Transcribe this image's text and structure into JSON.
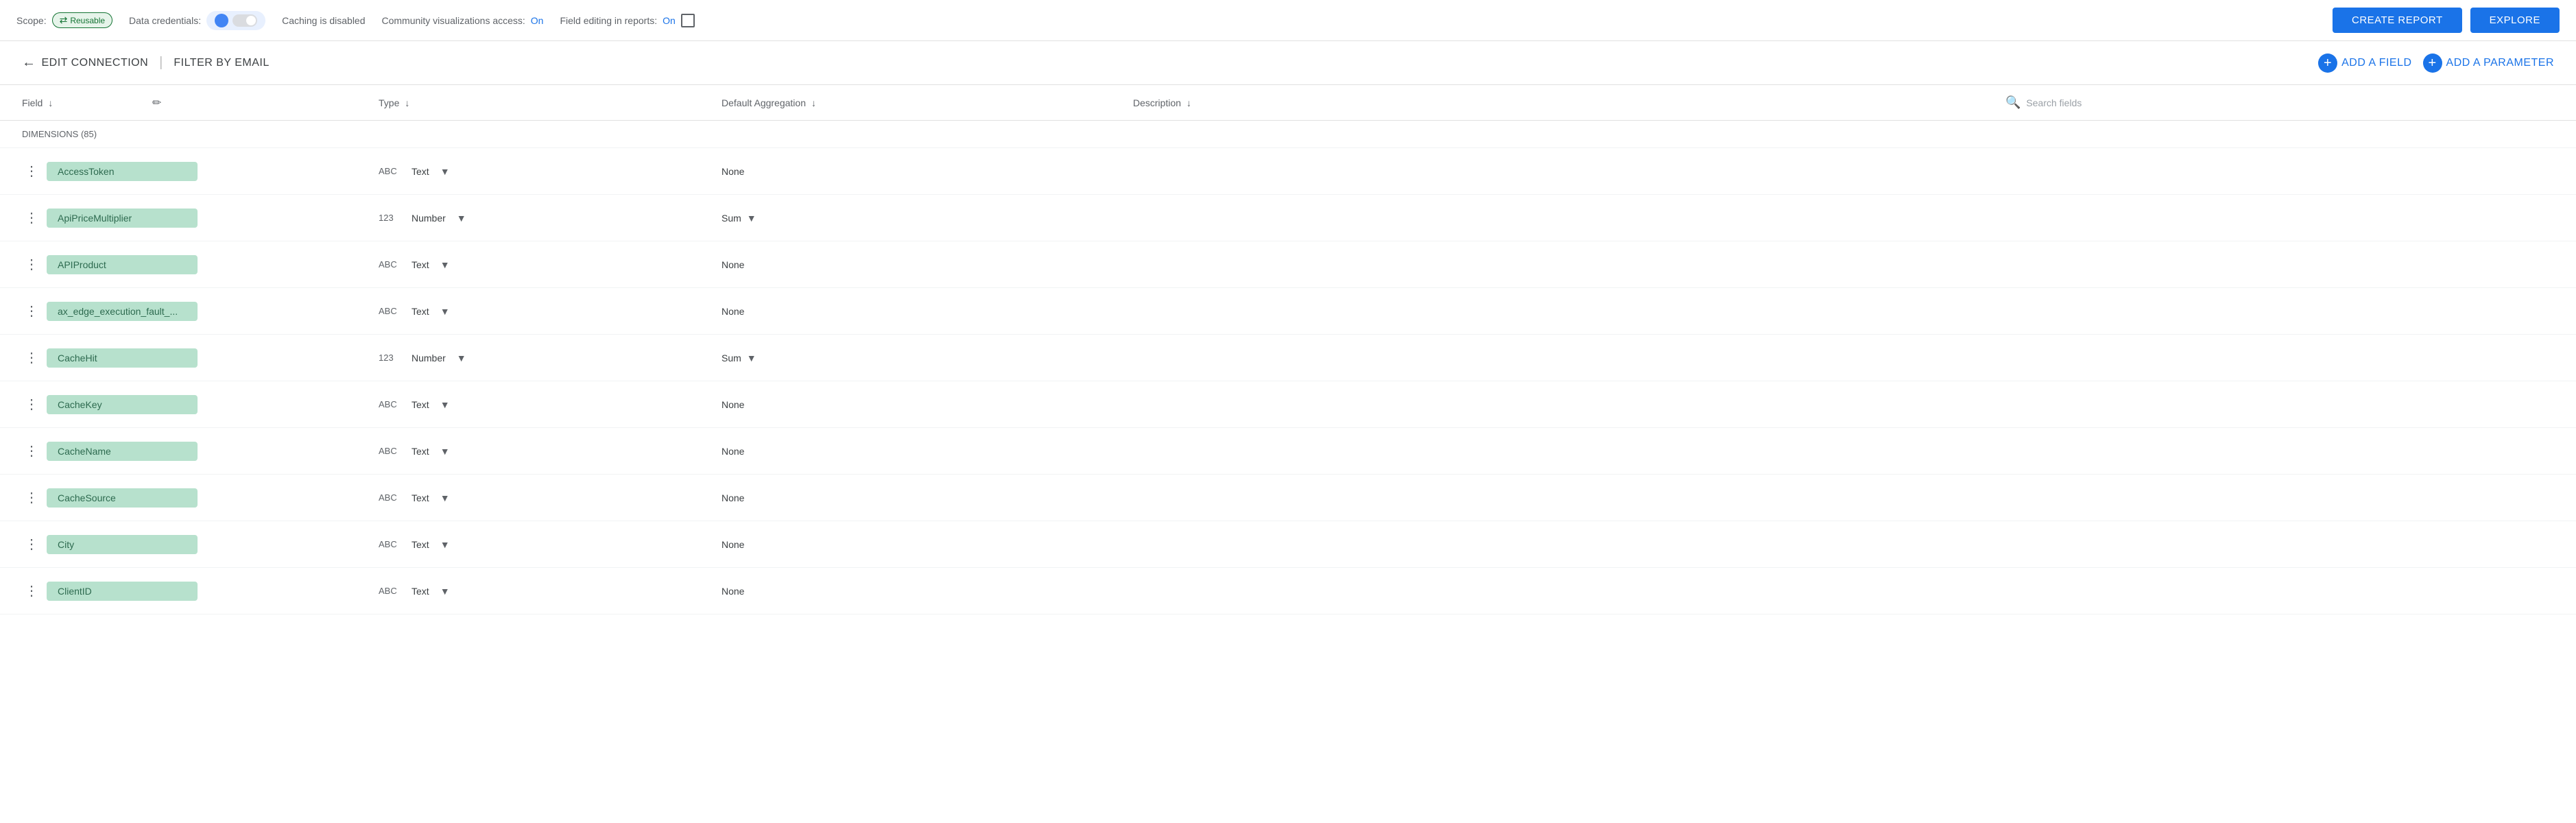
{
  "topbar": {
    "scope_label": "Scope:",
    "reusable_text": "Reusable",
    "data_credentials_label": "Data credentials:",
    "caching_label": "Caching is disabled",
    "community_label": "Community visualizations access:",
    "community_on": "On",
    "field_editing_label": "Field editing in reports:",
    "field_editing_on": "On",
    "create_report_btn": "CREATE REPORT",
    "explore_btn": "EXPLORE"
  },
  "subheader": {
    "edit_connection": "EDIT CONNECTION",
    "divider": "|",
    "filter_by_email": "FILTER BY EMAIL",
    "add_field_btn": "ADD A FIELD",
    "add_param_btn": "ADD A PARAMETER"
  },
  "table_header": {
    "field_col": "Field",
    "type_col": "Type",
    "aggregation_col": "Default Aggregation",
    "description_col": "Description",
    "search_placeholder": "Search fields"
  },
  "dimensions_label": "DIMENSIONS (85)",
  "rows": [
    {
      "field": "AccessToken",
      "type_icon": "ABC",
      "type": "Text",
      "aggregation": "None",
      "has_agg_dropdown": false,
      "has_type_dropdown": true
    },
    {
      "field": "ApiPriceMultiplier",
      "type_icon": "123",
      "type": "Number",
      "aggregation": "Sum",
      "has_agg_dropdown": true,
      "has_type_dropdown": true
    },
    {
      "field": "APIProduct",
      "type_icon": "ABC",
      "type": "Text",
      "aggregation": "None",
      "has_agg_dropdown": false,
      "has_type_dropdown": true
    },
    {
      "field": "ax_edge_execution_fault_...",
      "type_icon": "ABC",
      "type": "Text",
      "aggregation": "None",
      "has_agg_dropdown": false,
      "has_type_dropdown": true
    },
    {
      "field": "CacheHit",
      "type_icon": "123",
      "type": "Number",
      "aggregation": "Sum",
      "has_agg_dropdown": true,
      "has_type_dropdown": true
    },
    {
      "field": "CacheKey",
      "type_icon": "ABC",
      "type": "Text",
      "aggregation": "None",
      "has_agg_dropdown": false,
      "has_type_dropdown": true
    },
    {
      "field": "CacheName",
      "type_icon": "ABC",
      "type": "Text",
      "aggregation": "None",
      "has_agg_dropdown": false,
      "has_type_dropdown": true
    },
    {
      "field": "CacheSource",
      "type_icon": "ABC",
      "type": "Text",
      "aggregation": "None",
      "has_agg_dropdown": false,
      "has_type_dropdown": true
    },
    {
      "field": "City",
      "type_icon": "ABC",
      "type": "Text",
      "aggregation": "None",
      "has_agg_dropdown": false,
      "has_type_dropdown": true
    },
    {
      "field": "ClientID",
      "type_icon": "ABC",
      "type": "Text",
      "aggregation": "None",
      "has_agg_dropdown": false,
      "has_type_dropdown": true
    }
  ]
}
